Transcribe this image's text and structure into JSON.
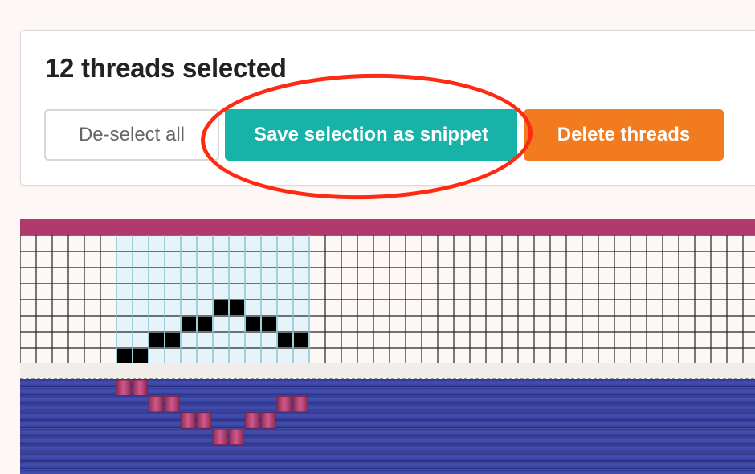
{
  "selection_panel": {
    "title": "12 threads selected",
    "deselect_label": "De-select all",
    "save_label": "Save selection as snippet",
    "delete_label": "Delete threads"
  },
  "draft": {
    "selected_thread_count": 12,
    "threading_pattern_shafts_from_bottom": [
      1,
      1,
      2,
      2,
      3,
      3,
      4,
      4,
      3,
      3,
      2,
      2
    ],
    "colors": {
      "warp_top": "#b03a6c",
      "weft": "#3a44a6",
      "selection": "#e6f4fa",
      "save_accent": "#17b2a8",
      "delete_accent": "#f27a1f",
      "annotation": "#ff2a12"
    }
  }
}
